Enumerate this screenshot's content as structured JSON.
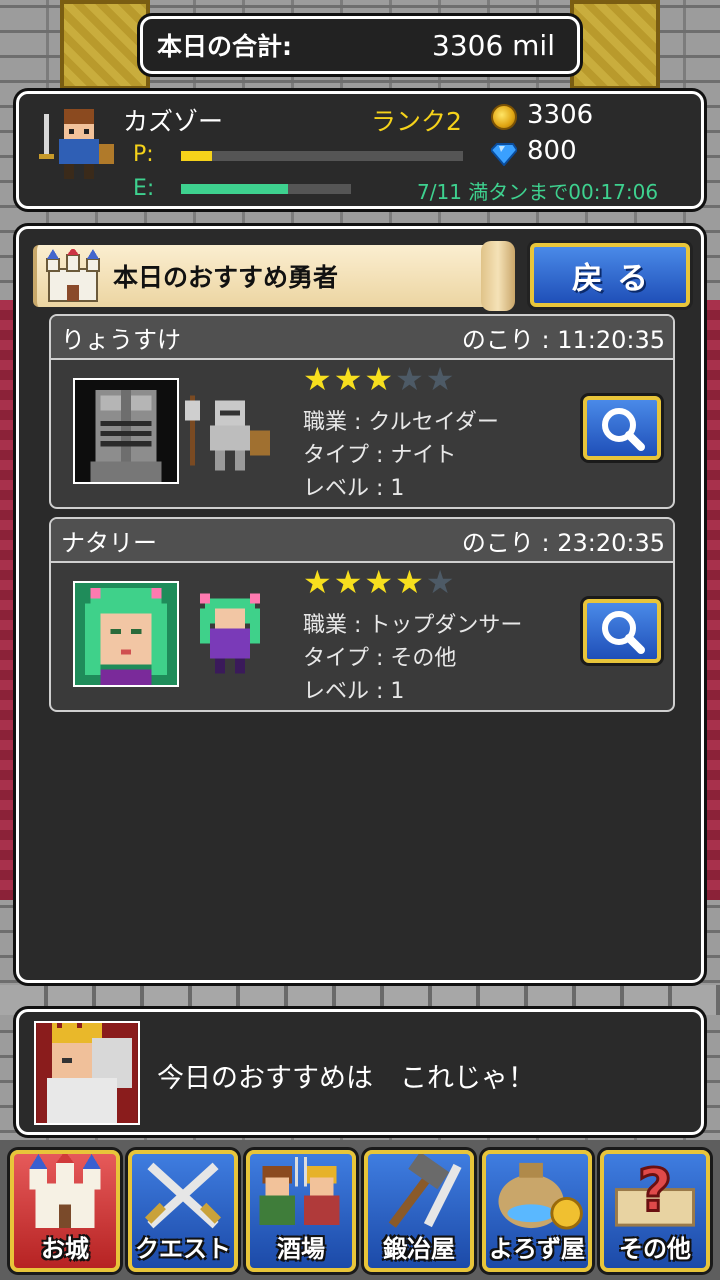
{
  "header": {
    "total_label": "本日の合計:",
    "total_value": "3306 mil"
  },
  "status": {
    "player_name": "カズゾー",
    "rank": "ランク2",
    "coins": "3306",
    "gems": "800",
    "p_label": "P:",
    "e_label": "E:",
    "p_progress": 0.11,
    "e_progress": 0.63,
    "stamina_text": "7/11 満タンまで00:17:06"
  },
  "main": {
    "title": "本日のおすすめ勇者",
    "back_label": "戻る",
    "heroes": [
      {
        "name": "りょうすけ",
        "remaining": "のこり : 11:20:35",
        "stars": 3,
        "max_stars": 5,
        "job": "職業 : クルセイダー",
        "type": "タイプ : ナイト",
        "level": "レベル : 1"
      },
      {
        "name": "ナタリー",
        "remaining": "のこり : 23:20:35",
        "stars": 4,
        "max_stars": 5,
        "job": "職業 : トップダンサー",
        "type": "タイプ : その他",
        "level": "レベル : 1"
      }
    ]
  },
  "message": {
    "text": "今日のおすすめは　これじゃ！"
  },
  "nav": [
    {
      "label": "お城",
      "icon": "castle-icon",
      "active": true
    },
    {
      "label": "クエスト",
      "icon": "swords-icon",
      "active": false
    },
    {
      "label": "酒場",
      "icon": "tavern-icon",
      "active": false
    },
    {
      "label": "鍛冶屋",
      "icon": "hammer-icon",
      "active": false
    },
    {
      "label": "よろず屋",
      "icon": "money-bag-icon",
      "active": false
    },
    {
      "label": "その他",
      "icon": "question-icon",
      "active": false
    }
  ],
  "colors": {
    "accent_yellow": "#f5d21a",
    "accent_green": "#3ed18f",
    "button_blue": "#2f66d0",
    "button_border": "#e8c53a"
  }
}
